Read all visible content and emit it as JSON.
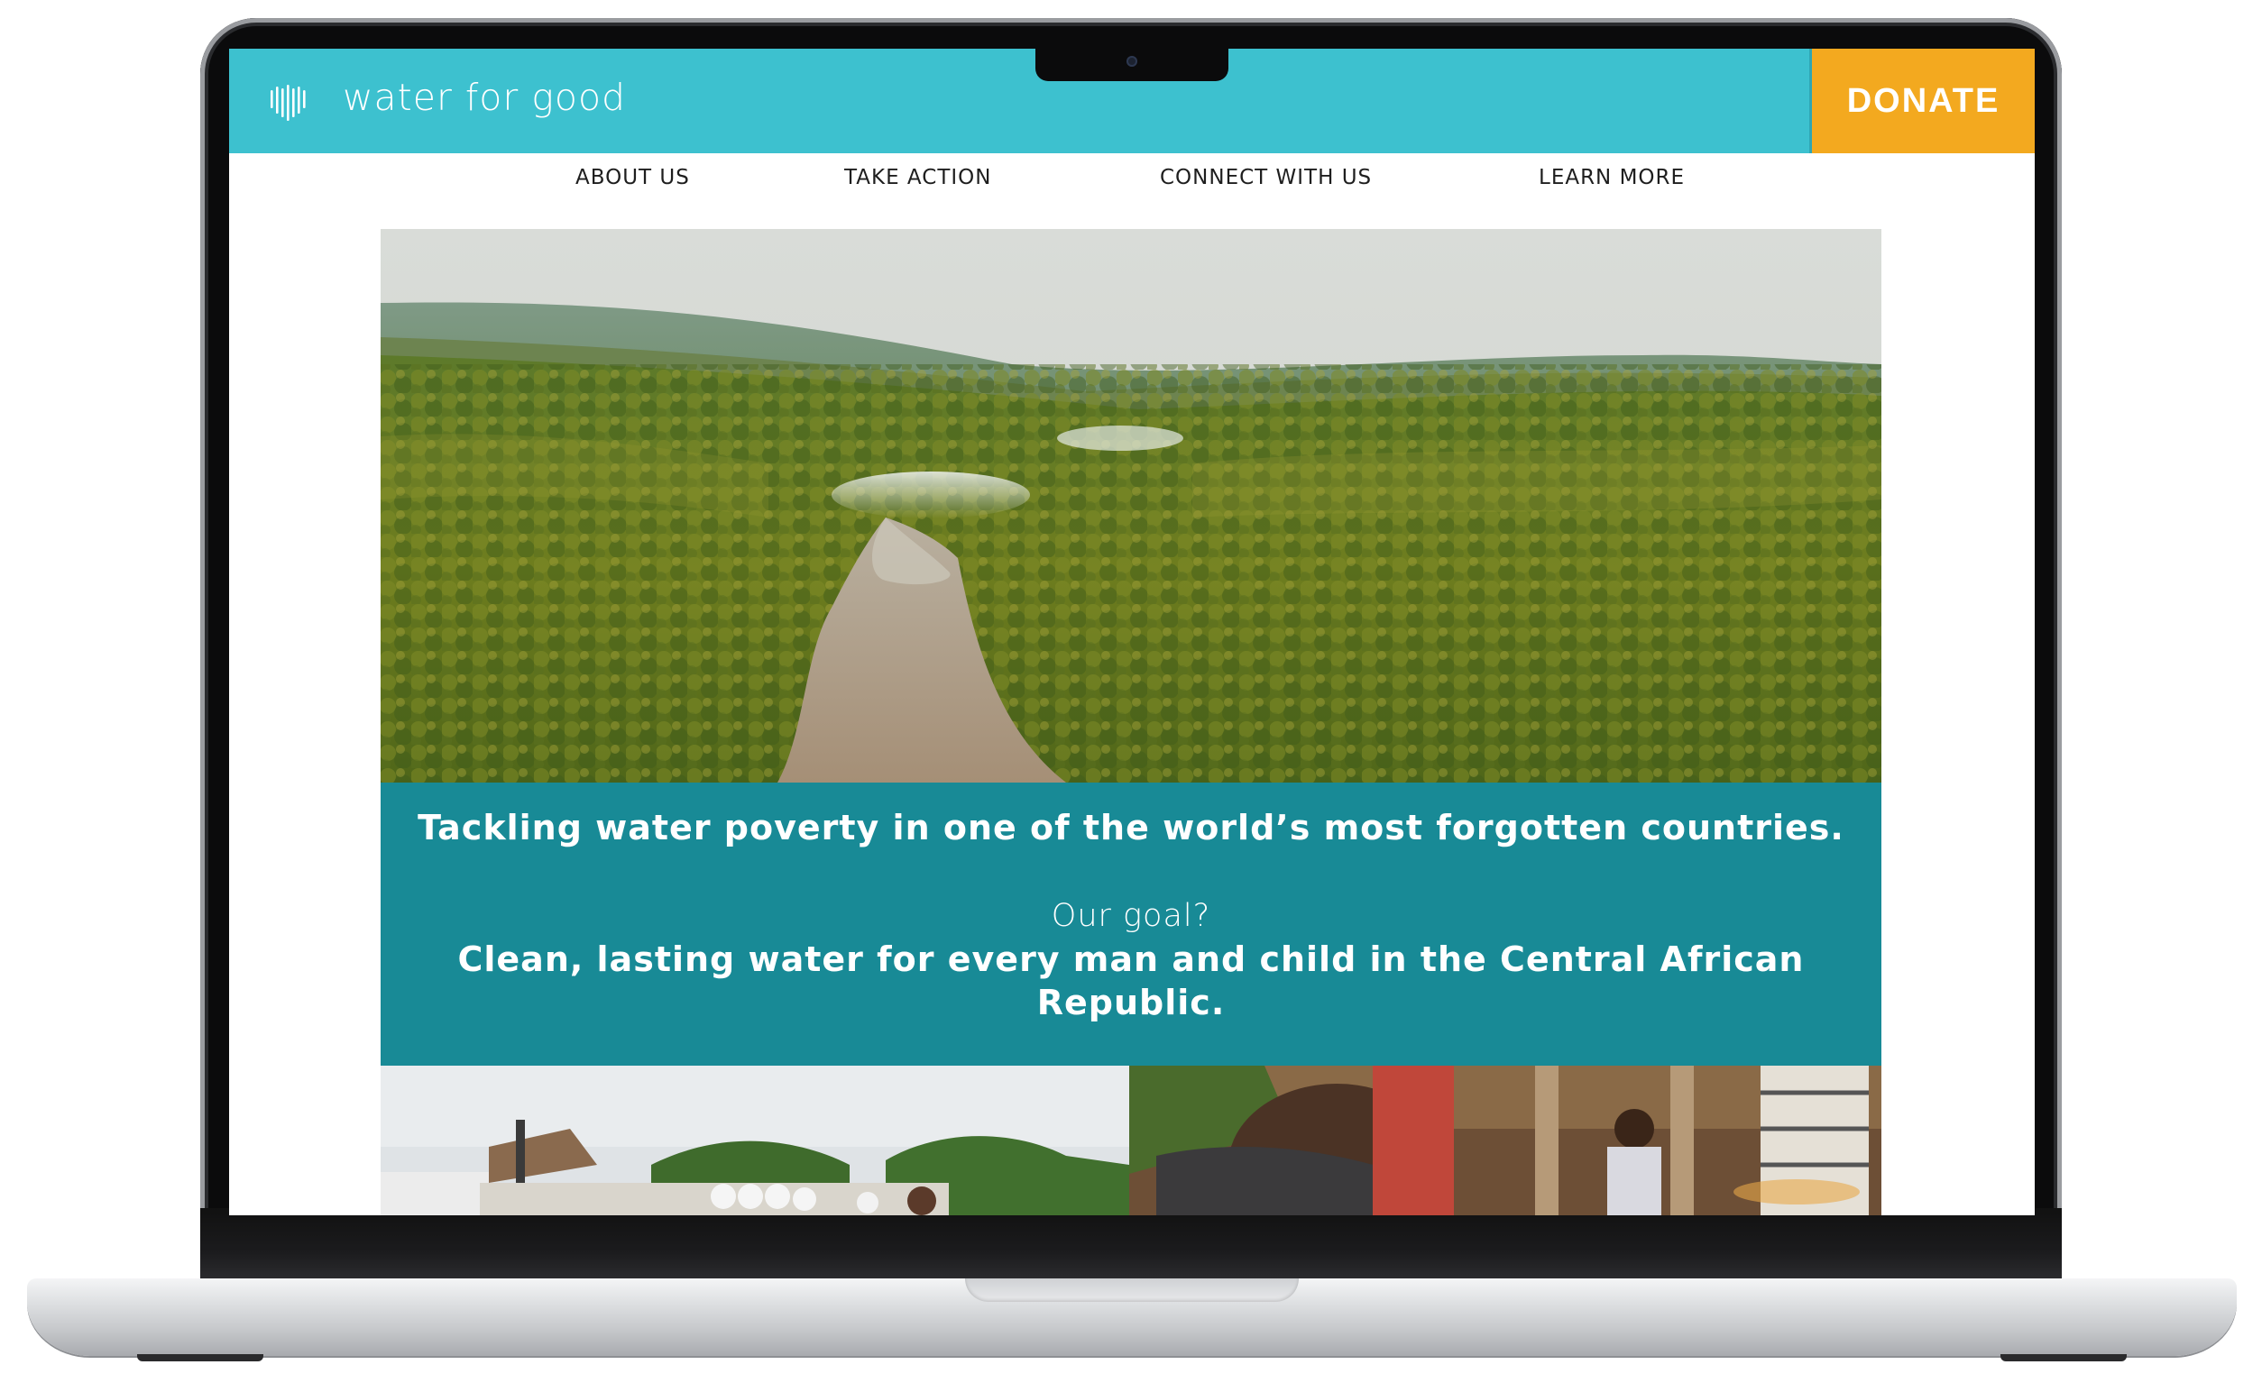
{
  "brand": {
    "logo_icon": "water-bars-icon",
    "name": "water for good",
    "color_header": "#3dc1cf",
    "color_donate": "#f3a91f",
    "color_panel": "#188a96"
  },
  "header": {
    "donate_label": "DONATE"
  },
  "nav": {
    "items": [
      {
        "label": "ABOUT US"
      },
      {
        "label": "TAKE ACTION"
      },
      {
        "label": "CONNECT WITH US"
      },
      {
        "label": "LEARN MORE"
      }
    ]
  },
  "mission": {
    "headline": "Tackling water poverty in one of the world’s most forgotten countries.",
    "question": "Our goal?",
    "goal": "Clean, lasting water for every man and child in the Central African Republic."
  }
}
